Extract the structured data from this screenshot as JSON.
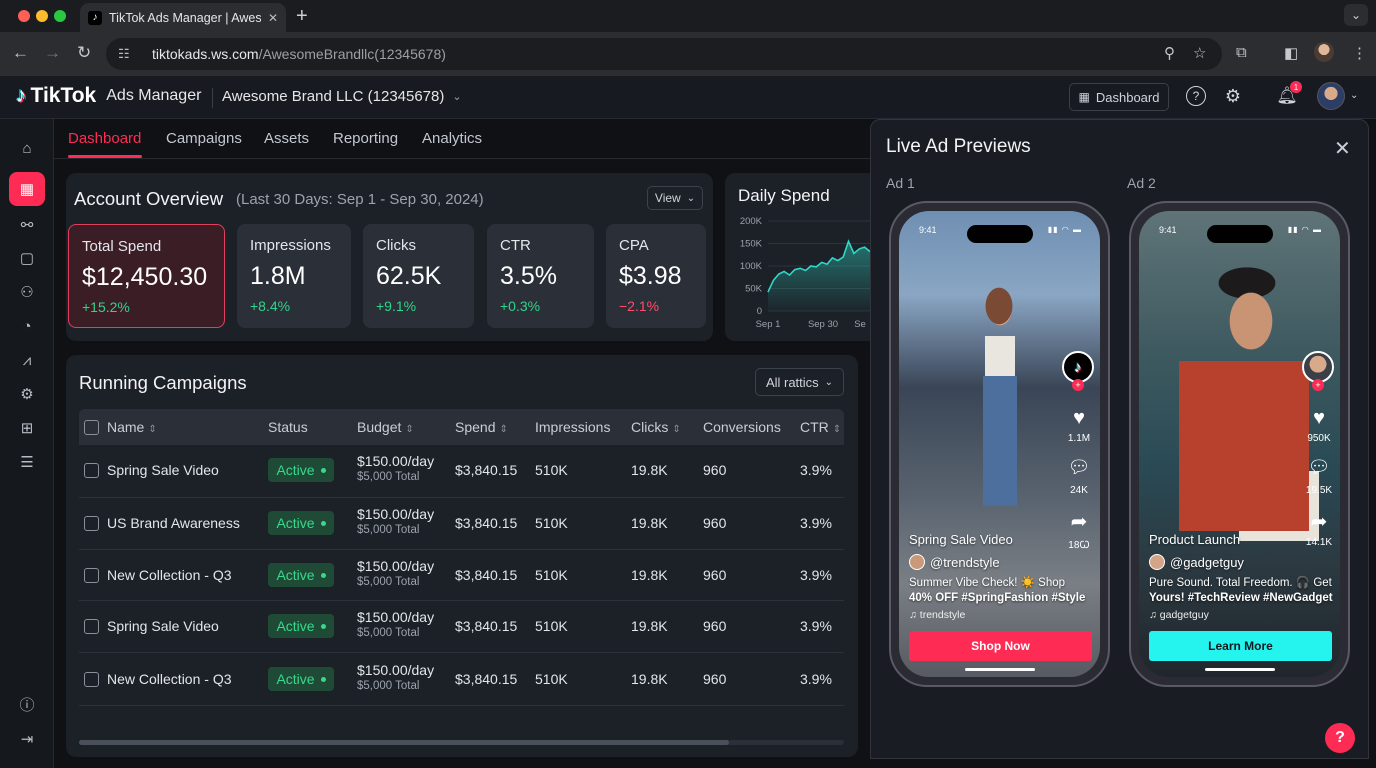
{
  "browser": {
    "tab_title": "TikTok Ads Manager | AwesomeBrand",
    "url_host": "tiktokads.ws.com",
    "url_path": "/AwesomeBrandllc(12345678)"
  },
  "header": {
    "brand": "TikTok",
    "product": "Ads Manager",
    "account": "Awesome Brand LLC (12345678)",
    "dashboard_button": "Dashboard",
    "notification_count": "1"
  },
  "sidebar": {
    "items": [
      {
        "icon": "home-icon"
      },
      {
        "icon": "dashboard-grid-icon",
        "active": true
      },
      {
        "icon": "audience-icon"
      },
      {
        "icon": "creative-icon"
      },
      {
        "icon": "users-icon"
      },
      {
        "icon": "pie-chart-icon"
      },
      {
        "icon": "line-chart-icon"
      },
      {
        "icon": "settings-gear-icon"
      },
      {
        "icon": "add-asset-icon"
      },
      {
        "icon": "list-icon"
      }
    ],
    "bottom": [
      {
        "icon": "help-icon"
      },
      {
        "icon": "logout-icon"
      }
    ]
  },
  "nav": {
    "tabs": [
      "Dashboard",
      "Campaigns",
      "Assets",
      "Reporting",
      "Analytics"
    ],
    "active": "Dashboard"
  },
  "overview": {
    "title": "Account Overview",
    "subtitle": "(Last 30 Days: Sep 1 - Sep 30, 2024)",
    "view_button": "View",
    "kpis": [
      {
        "label": "Total Spend",
        "value": "$12,450.30",
        "change": "+15.2%"
      },
      {
        "label": "Impressions",
        "value": "1.8M",
        "change": "+8.4%"
      },
      {
        "label": "Clicks",
        "value": "62.5K",
        "change": "+9.1%"
      },
      {
        "label": "CTR",
        "value": "3.5%",
        "change": "+0.3%"
      },
      {
        "label": "CPA",
        "value": "$3.98",
        "change": "−2.1%"
      }
    ]
  },
  "daily_spend": {
    "title": "Daily Spend",
    "y_ticks": [
      "200K",
      "150K",
      "100K",
      "50K",
      "0"
    ],
    "x_ticks": [
      "Sep 1",
      "Sep 30",
      "Se"
    ],
    "color": "#2fd8c6"
  },
  "chart_data": {
    "type": "area",
    "title": "Daily Spend",
    "ylim": [
      0,
      200000
    ],
    "x": [
      1,
      2,
      3,
      4,
      5,
      6,
      7,
      8,
      9,
      10,
      11,
      12,
      13,
      14,
      15,
      16,
      17,
      18,
      19,
      20
    ],
    "series": [
      {
        "values": [
          42000,
          68000,
          82000,
          88000,
          80000,
          92000,
          95000,
          90000,
          100000,
          98000,
          108000,
          104000,
          118000,
          112000,
          120000,
          155000,
          128000,
          138000,
          142000,
          132000
        ]
      }
    ]
  },
  "campaigns": {
    "title": "Running Campaigns",
    "metrics_button": "All rattics",
    "columns": [
      "Name",
      "Status",
      "Budget",
      "Spend",
      "Impressions",
      "Clicks",
      "Conversions",
      "CTR"
    ],
    "rows": [
      {
        "name": "Spring Sale Video",
        "status": "Active",
        "budget": "$150.00/day",
        "budget_total": "$5,000 Total",
        "spend": "$3,840.15",
        "impressions": "510K",
        "clicks": "19.8K",
        "conversions": "960",
        "ctr": "3.9%"
      },
      {
        "name": "US Brand Awareness",
        "status": "Active",
        "budget": "$150.00/day",
        "budget_total": "$5,000 Total",
        "spend": "$3,840.15",
        "impressions": "510K",
        "clicks": "19.8K",
        "conversions": "960",
        "ctr": "3.9%"
      },
      {
        "name": "New Collection - Q3",
        "status": "Active",
        "budget": "$150.00/day",
        "budget_total": "$5,000 Total",
        "spend": "$3,840.15",
        "impressions": "510K",
        "clicks": "19.8K",
        "conversions": "960",
        "ctr": "3.9%"
      },
      {
        "name": "Spring Sale Video",
        "status": "Active",
        "budget": "$150.00/day",
        "budget_total": "$5,000 Total",
        "spend": "$3,840.15",
        "impressions": "510K",
        "clicks": "19.8K",
        "conversions": "960",
        "ctr": "3.9%"
      },
      {
        "name": "New Collection - Q3",
        "status": "Active",
        "budget": "$150.00/day",
        "budget_total": "$5,000 Total",
        "spend": "$3,840.15",
        "impressions": "510K",
        "clicks": "19.8K",
        "conversions": "960",
        "ctr": "3.9%"
      }
    ]
  },
  "previews": {
    "title": "Live Ad Previews",
    "ads": [
      {
        "label": "Ad 1",
        "time": "9:41",
        "video_title": "Spring Sale Video",
        "handle": "@trendstyle",
        "caption_plain": "Summer Vibe Check! ☀️ Shop",
        "caption_bold": "40% OFF #SpringFashion #Style",
        "music": "♫ trendstyle",
        "likes": "1.1M",
        "comments": "24K",
        "shares": "18Ꞷ",
        "cta": "Shop Now",
        "cta_color": "#fe2c55"
      },
      {
        "label": "Ad 2",
        "time": "9:41",
        "video_title": "Product Launch",
        "handle": "@gadgetguy",
        "caption_plain": "Pure Sound. Total Freedom. 🎧 Get",
        "caption_bold": "Yours! #TechReview #NewGadget",
        "music": "♫ gadgetguy",
        "likes": "950K",
        "comments": "19.5K",
        "shares": "14.1K",
        "cta": "Learn More",
        "cta_color": "#25f4ee"
      }
    ]
  }
}
